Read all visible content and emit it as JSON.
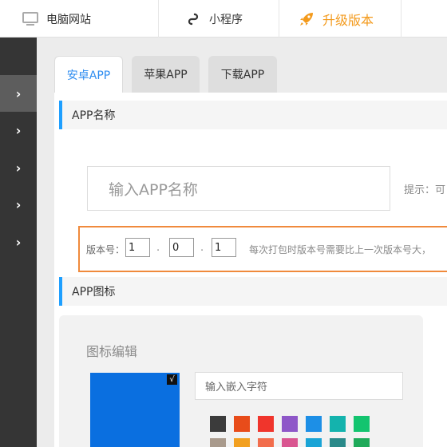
{
  "topbar": {
    "items": [
      {
        "label": "电脑网站",
        "icon": "monitor-icon"
      },
      {
        "label": "小程序",
        "icon": "miniprogram-icon"
      },
      {
        "label": "升级版本",
        "icon": "rocket-icon"
      }
    ]
  },
  "sidebar": {
    "items": [
      {
        "icon": "chevron-right-icon",
        "active": true
      },
      {
        "icon": "chevron-right-icon",
        "active": false
      },
      {
        "icon": "chevron-right-icon",
        "active": false
      },
      {
        "icon": "chevron-right-icon",
        "active": false
      },
      {
        "icon": "chevron-right-icon",
        "active": false
      }
    ]
  },
  "tabs": [
    {
      "label": "安卓APP",
      "active": true
    },
    {
      "label": "苹果APP",
      "active": false
    },
    {
      "label": "下载APP",
      "active": false
    }
  ],
  "app_name": {
    "heading": "APP名称",
    "placeholder": "输入APP名称",
    "hint": "提示：可"
  },
  "version": {
    "label": "版本号：",
    "major": "1",
    "minor": "0",
    "patch": "1",
    "dot": ".",
    "note": "每次打包时版本号需要比上一次版本号大，"
  },
  "app_icon": {
    "heading": "APP图标",
    "editor_title": "图标编辑",
    "preview_color": "#0a6fe0",
    "check_glyph": "√",
    "embed_placeholder": "输入嵌入字符",
    "swatches_row1": [
      "#3b3b3b",
      "#e84c1a",
      "#f0352c",
      "#8e57c8",
      "#1d8fe6",
      "#14b3ad",
      "#13c46f"
    ],
    "swatches_row2": [
      "#a99a8c",
      "#f2a020",
      "#f26d4c",
      "#d95590",
      "#1aa4d6",
      "#2a8a8a",
      "#1faa5a"
    ]
  },
  "colors": {
    "accent": "#1e9fff",
    "upgrade": "#f39a1c",
    "version_border": "#f08a3c",
    "sidebar": "#353535",
    "tab_active_text": "#2d8cf0"
  }
}
